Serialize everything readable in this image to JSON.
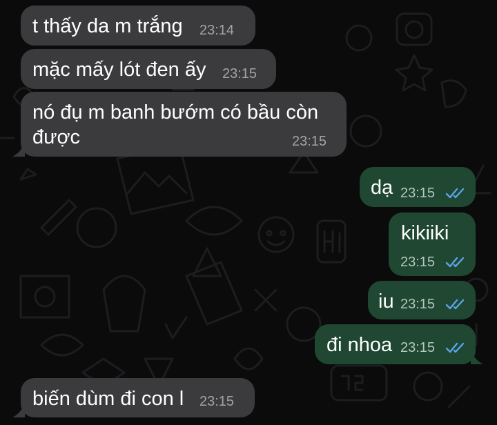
{
  "conversation": {
    "messages": [
      {
        "direction": "incoming",
        "text": "t thấy da m trắng",
        "time": "23:14"
      },
      {
        "direction": "incoming",
        "text": "mặc mấy lót đen ấy",
        "time": "23:15"
      },
      {
        "direction": "incoming",
        "text_line1": "nó đụ m banh bướm có bầu còn",
        "text_line2": "được",
        "time": "23:15"
      },
      {
        "direction": "outgoing",
        "text": "dạ",
        "time": "23:15",
        "status": "read",
        "status_icon": "double-check-icon"
      },
      {
        "direction": "outgoing",
        "text": "kikiiki",
        "time": "23:15",
        "status": "read",
        "status_icon": "double-check-icon"
      },
      {
        "direction": "outgoing",
        "text": "iu",
        "time": "23:15",
        "status": "read",
        "status_icon": "double-check-icon"
      },
      {
        "direction": "outgoing",
        "text": "đi nhoa",
        "time": "23:15",
        "status": "read",
        "status_icon": "double-check-icon"
      },
      {
        "direction": "incoming",
        "text": "biến dùm đi con l",
        "time": "23:15"
      }
    ]
  },
  "colors": {
    "background": "#0b0b0b",
    "incoming_bubble": "#3b3b3d",
    "outgoing_bubble": "#1f4731",
    "read_ticks": "#5aa4ea"
  }
}
